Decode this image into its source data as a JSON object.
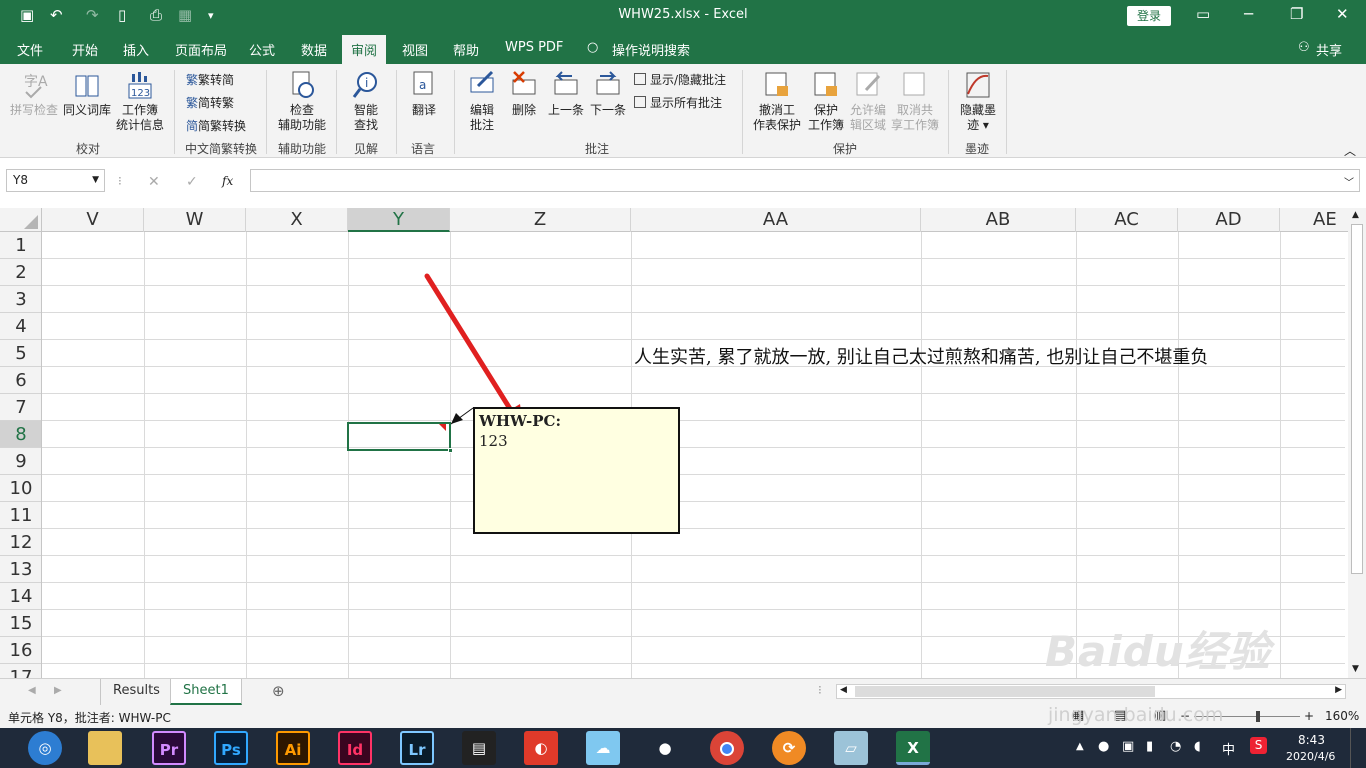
{
  "window": {
    "title": "WHW25.xlsx  -  Excel",
    "login_label": "登录",
    "share_label": "共享"
  },
  "ribbon_tabs": [
    {
      "label": "文件"
    },
    {
      "label": "开始"
    },
    {
      "label": "插入"
    },
    {
      "label": "页面布局"
    },
    {
      "label": "公式"
    },
    {
      "label": "数据"
    },
    {
      "label": "审阅"
    },
    {
      "label": "视图"
    },
    {
      "label": "帮助"
    },
    {
      "label": "WPS PDF"
    },
    {
      "label": "操作说明搜索"
    }
  ],
  "ribbon": {
    "spell_check": "拼写检查",
    "thesaurus": "同义词库",
    "workbook_stats_1": "工作簿",
    "workbook_stats_2": "统计信息",
    "proofing": "校对",
    "to_simplified": "繁转简",
    "to_traditional": "简转繁",
    "conversion": "简繁转换",
    "chinese_group": "中文简繁转换",
    "accessibility_1": "检查",
    "accessibility_2": "辅助功能",
    "accessibility_group": "辅助功能",
    "smart_lookup_1": "智能",
    "smart_lookup_2": "查找",
    "insights": "见解",
    "translate": "翻译",
    "language": "语言",
    "edit_comment_1": "编辑",
    "edit_comment_2": "批注",
    "delete": "删除",
    "previous": "上一条",
    "next": "下一条",
    "show_hide_comment": "显示/隐藏批注",
    "show_all_comments": "显示所有批注",
    "comments_group": "批注",
    "unprotect_sheet_1": "撤消工",
    "unprotect_sheet_2": "作表保护",
    "protect_workbook_1": "保护",
    "protect_workbook_2": "工作簿",
    "allow_edit_1": "允许编",
    "allow_edit_2": "辑区域",
    "unshare_1": "取消共",
    "unshare_2": "享工作簿",
    "protect_group": "保护",
    "hide_ink_1": "隐藏墨",
    "hide_ink_2": "迹",
    "ink_group": "墨迹"
  },
  "formula_bar": {
    "name_box": "Y8",
    "fx": "fx",
    "value": ""
  },
  "columns": [
    "V",
    "W",
    "X",
    "Y",
    "Z",
    "AA",
    "AB",
    "AC",
    "AD",
    "AE"
  ],
  "rows": [
    "1",
    "2",
    "3",
    "4",
    "5",
    "6",
    "7",
    "8",
    "9",
    "10",
    "11",
    "12",
    "13",
    "14",
    "15",
    "16",
    "17"
  ],
  "cell_text": {
    "Z5": "人生实苦, 累了就放一放, 别让自己太过煎熬和痛苦, 也别让自己不堪重负"
  },
  "comment": {
    "author": "WHW-PC:",
    "body": "123"
  },
  "sheets": [
    {
      "name": "Results"
    },
    {
      "name": "Sheet1",
      "active": true
    }
  ],
  "status": {
    "text": "单元格 Y8，批注者: WHW-PC",
    "zoom": "160%"
  },
  "taskbar": {
    "apps": [
      "Pr",
      "Ps",
      "Ai",
      "Id",
      "Lr"
    ],
    "time": "8:43",
    "date": "2020/4/6",
    "ime": "中"
  },
  "watermark": {
    "logo": "Baidu经验",
    "url": "jingyan.baidu.com"
  },
  "colors": {
    "excel_green": "#217346",
    "comment_bg": "#ffffe1",
    "arrow": "#e02020"
  }
}
